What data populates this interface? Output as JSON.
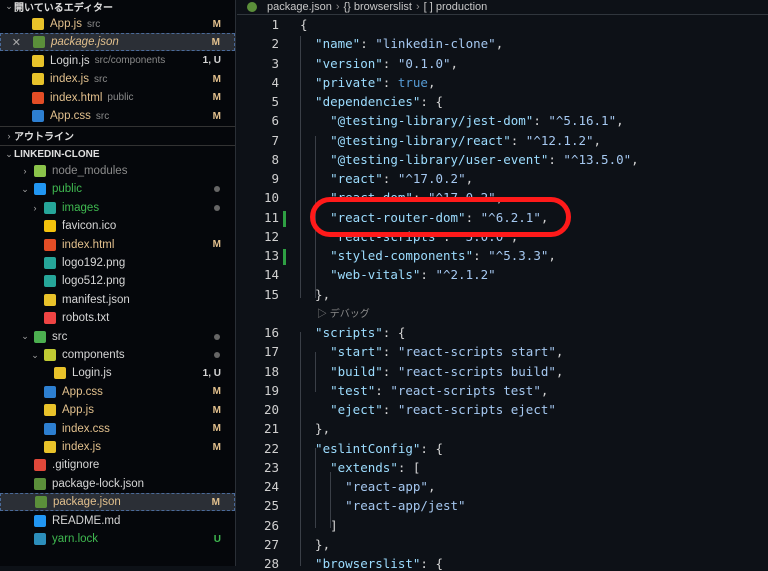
{
  "sidebar": {
    "open_editors_title": "開いているエディター",
    "open_editors": [
      {
        "name": "App.js",
        "desc": "src",
        "status": "M",
        "icon": "js-icon"
      },
      {
        "name": "package.json",
        "desc": "",
        "status": "M",
        "icon": "nodejs-icon"
      },
      {
        "name": "Login.js",
        "desc": "src/components",
        "status": "1, U",
        "icon": "js-icon"
      },
      {
        "name": "index.js",
        "desc": "src",
        "status": "M",
        "icon": "js-icon"
      },
      {
        "name": "index.html",
        "desc": "public",
        "status": "M",
        "icon": "html-icon"
      },
      {
        "name": "App.css",
        "desc": "src",
        "status": "M",
        "icon": "css-icon"
      }
    ],
    "outline_title": "アウトライン",
    "project_title": "LINKEDIN-CLONE",
    "tree": [
      {
        "name": "node_modules",
        "status": "",
        "icon": "folder-node-icon"
      },
      {
        "name": "public",
        "status": "dot",
        "icon": "folder-public-icon"
      },
      {
        "name": "images",
        "status": "dot",
        "icon": "folder-images-icon"
      },
      {
        "name": "favicon.ico",
        "status": "",
        "icon": "star-icon"
      },
      {
        "name": "index.html",
        "status": "M",
        "icon": "html-icon"
      },
      {
        "name": "logo192.png",
        "status": "",
        "icon": "image-icon"
      },
      {
        "name": "logo512.png",
        "status": "",
        "icon": "image-icon"
      },
      {
        "name": "manifest.json",
        "status": "",
        "icon": "json-icon"
      },
      {
        "name": "robots.txt",
        "status": "",
        "icon": "robot-icon"
      },
      {
        "name": "src",
        "status": "dot",
        "icon": "folder-src-icon"
      },
      {
        "name": "components",
        "status": "dot",
        "icon": "folder-components-icon"
      },
      {
        "name": "Login.js",
        "status": "1, U",
        "icon": "js-icon"
      },
      {
        "name": "App.css",
        "status": "M",
        "icon": "css-icon"
      },
      {
        "name": "App.js",
        "status": "M",
        "icon": "js-icon"
      },
      {
        "name": "index.css",
        "status": "M",
        "icon": "css-icon"
      },
      {
        "name": "index.js",
        "status": "M",
        "icon": "js-icon"
      },
      {
        "name": ".gitignore",
        "status": "",
        "icon": "git-icon"
      },
      {
        "name": "package-lock.json",
        "status": "",
        "icon": "nodejs-icon"
      },
      {
        "name": "package.json",
        "status": "M",
        "icon": "nodejs-icon"
      },
      {
        "name": "README.md",
        "status": "",
        "icon": "info-icon"
      },
      {
        "name": "yarn.lock",
        "status": "U",
        "icon": "yarn-icon"
      }
    ]
  },
  "breadcrumb": [
    "package.json",
    "{} browserslist",
    "[ ] production"
  ],
  "codelens": "▷ デバッグ",
  "code": [
    [
      "1",
      0,
      [
        [
          "p",
          "{"
        ]
      ]
    ],
    [
      "2",
      1,
      [
        [
          "k",
          "\"name\""
        ],
        [
          "p",
          ": "
        ],
        [
          "s",
          "\"linkedin-clone\""
        ],
        [
          "p",
          ","
        ]
      ]
    ],
    [
      "3",
      1,
      [
        [
          "k",
          "\"version\""
        ],
        [
          "p",
          ": "
        ],
        [
          "s",
          "\"0.1.0\""
        ],
        [
          "p",
          ","
        ]
      ]
    ],
    [
      "4",
      1,
      [
        [
          "k",
          "\"private\""
        ],
        [
          "p",
          ": "
        ],
        [
          "b",
          "true"
        ],
        [
          "p",
          ","
        ]
      ]
    ],
    [
      "5",
      1,
      [
        [
          "k",
          "\"dependencies\""
        ],
        [
          "p",
          ": {"
        ]
      ]
    ],
    [
      "6",
      2,
      [
        [
          "k",
          "\"@testing-library/jest-dom\""
        ],
        [
          "p",
          ": "
        ],
        [
          "s",
          "\"^5.16.1\""
        ],
        [
          "p",
          ","
        ]
      ]
    ],
    [
      "7",
      2,
      [
        [
          "k",
          "\"@testing-library/react\""
        ],
        [
          "p",
          ": "
        ],
        [
          "s",
          "\"^12.1.2\""
        ],
        [
          "p",
          ","
        ]
      ]
    ],
    [
      "8",
      2,
      [
        [
          "k",
          "\"@testing-library/user-event\""
        ],
        [
          "p",
          ": "
        ],
        [
          "s",
          "\"^13.5.0\""
        ],
        [
          "p",
          ","
        ]
      ]
    ],
    [
      "9",
      2,
      [
        [
          "k",
          "\"react\""
        ],
        [
          "p",
          ": "
        ],
        [
          "s",
          "\"^17.0.2\""
        ],
        [
          "p",
          ","
        ]
      ]
    ],
    [
      "10",
      2,
      [
        [
          "k",
          "\"react-dom\""
        ],
        [
          "p",
          ": "
        ],
        [
          "s",
          "\"^17.0.2\""
        ],
        [
          "p",
          ","
        ]
      ]
    ],
    [
      "11",
      2,
      [
        [
          "k",
          "\"react-router-dom\""
        ],
        [
          "p",
          ": "
        ],
        [
          "s",
          "\"^6.2.1\""
        ],
        [
          "p",
          ","
        ]
      ]
    ],
    [
      "12",
      2,
      [
        [
          "k",
          "\"react-scripts\""
        ],
        [
          "p",
          ": "
        ],
        [
          "s",
          "\"5.0.0\""
        ],
        [
          "p",
          ","
        ]
      ]
    ],
    [
      "13",
      2,
      [
        [
          "k",
          "\"styled-components\""
        ],
        [
          "p",
          ": "
        ],
        [
          "s",
          "\"^5.3.3\""
        ],
        [
          "p",
          ","
        ]
      ]
    ],
    [
      "14",
      2,
      [
        [
          "k",
          "\"web-vitals\""
        ],
        [
          "p",
          ": "
        ],
        [
          "s",
          "\"^2.1.2\""
        ]
      ]
    ],
    [
      "15",
      1,
      [
        [
          "p",
          "},"
        ]
      ]
    ],
    [
      "16",
      1,
      [
        [
          "k",
          "\"scripts\""
        ],
        [
          "p",
          ": {"
        ]
      ]
    ],
    [
      "17",
      2,
      [
        [
          "k",
          "\"start\""
        ],
        [
          "p",
          ": "
        ],
        [
          "s",
          "\"react-scripts start\""
        ],
        [
          "p",
          ","
        ]
      ]
    ],
    [
      "18",
      2,
      [
        [
          "k",
          "\"build\""
        ],
        [
          "p",
          ": "
        ],
        [
          "s",
          "\"react-scripts build\""
        ],
        [
          "p",
          ","
        ]
      ]
    ],
    [
      "19",
      2,
      [
        [
          "k",
          "\"test\""
        ],
        [
          "p",
          ": "
        ],
        [
          "s",
          "\"react-scripts test\""
        ],
        [
          "p",
          ","
        ]
      ]
    ],
    [
      "20",
      2,
      [
        [
          "k",
          "\"eject\""
        ],
        [
          "p",
          ": "
        ],
        [
          "s",
          "\"react-scripts eject\""
        ]
      ]
    ],
    [
      "21",
      1,
      [
        [
          "p",
          "},"
        ]
      ]
    ],
    [
      "22",
      1,
      [
        [
          "k",
          "\"eslintConfig\""
        ],
        [
          "p",
          ": {"
        ]
      ]
    ],
    [
      "23",
      2,
      [
        [
          "k",
          "\"extends\""
        ],
        [
          "p",
          ": ["
        ]
      ]
    ],
    [
      "24",
      3,
      [
        [
          "s",
          "\"react-app\""
        ],
        [
          "p",
          ","
        ]
      ]
    ],
    [
      "25",
      3,
      [
        [
          "s",
          "\"react-app/jest\""
        ]
      ]
    ],
    [
      "26",
      2,
      [
        [
          "p",
          "]"
        ]
      ]
    ],
    [
      "27",
      1,
      [
        [
          "p",
          "},"
        ]
      ]
    ],
    [
      "28",
      1,
      [
        [
          "k",
          "\"browserslist\""
        ],
        [
          "p",
          ": {"
        ]
      ]
    ]
  ],
  "changed_lines": [
    "11",
    "13"
  ],
  "colors": {
    "highlight": "#ff1a1a",
    "modified": "#e2c08d",
    "untracked": "#3fb950"
  }
}
